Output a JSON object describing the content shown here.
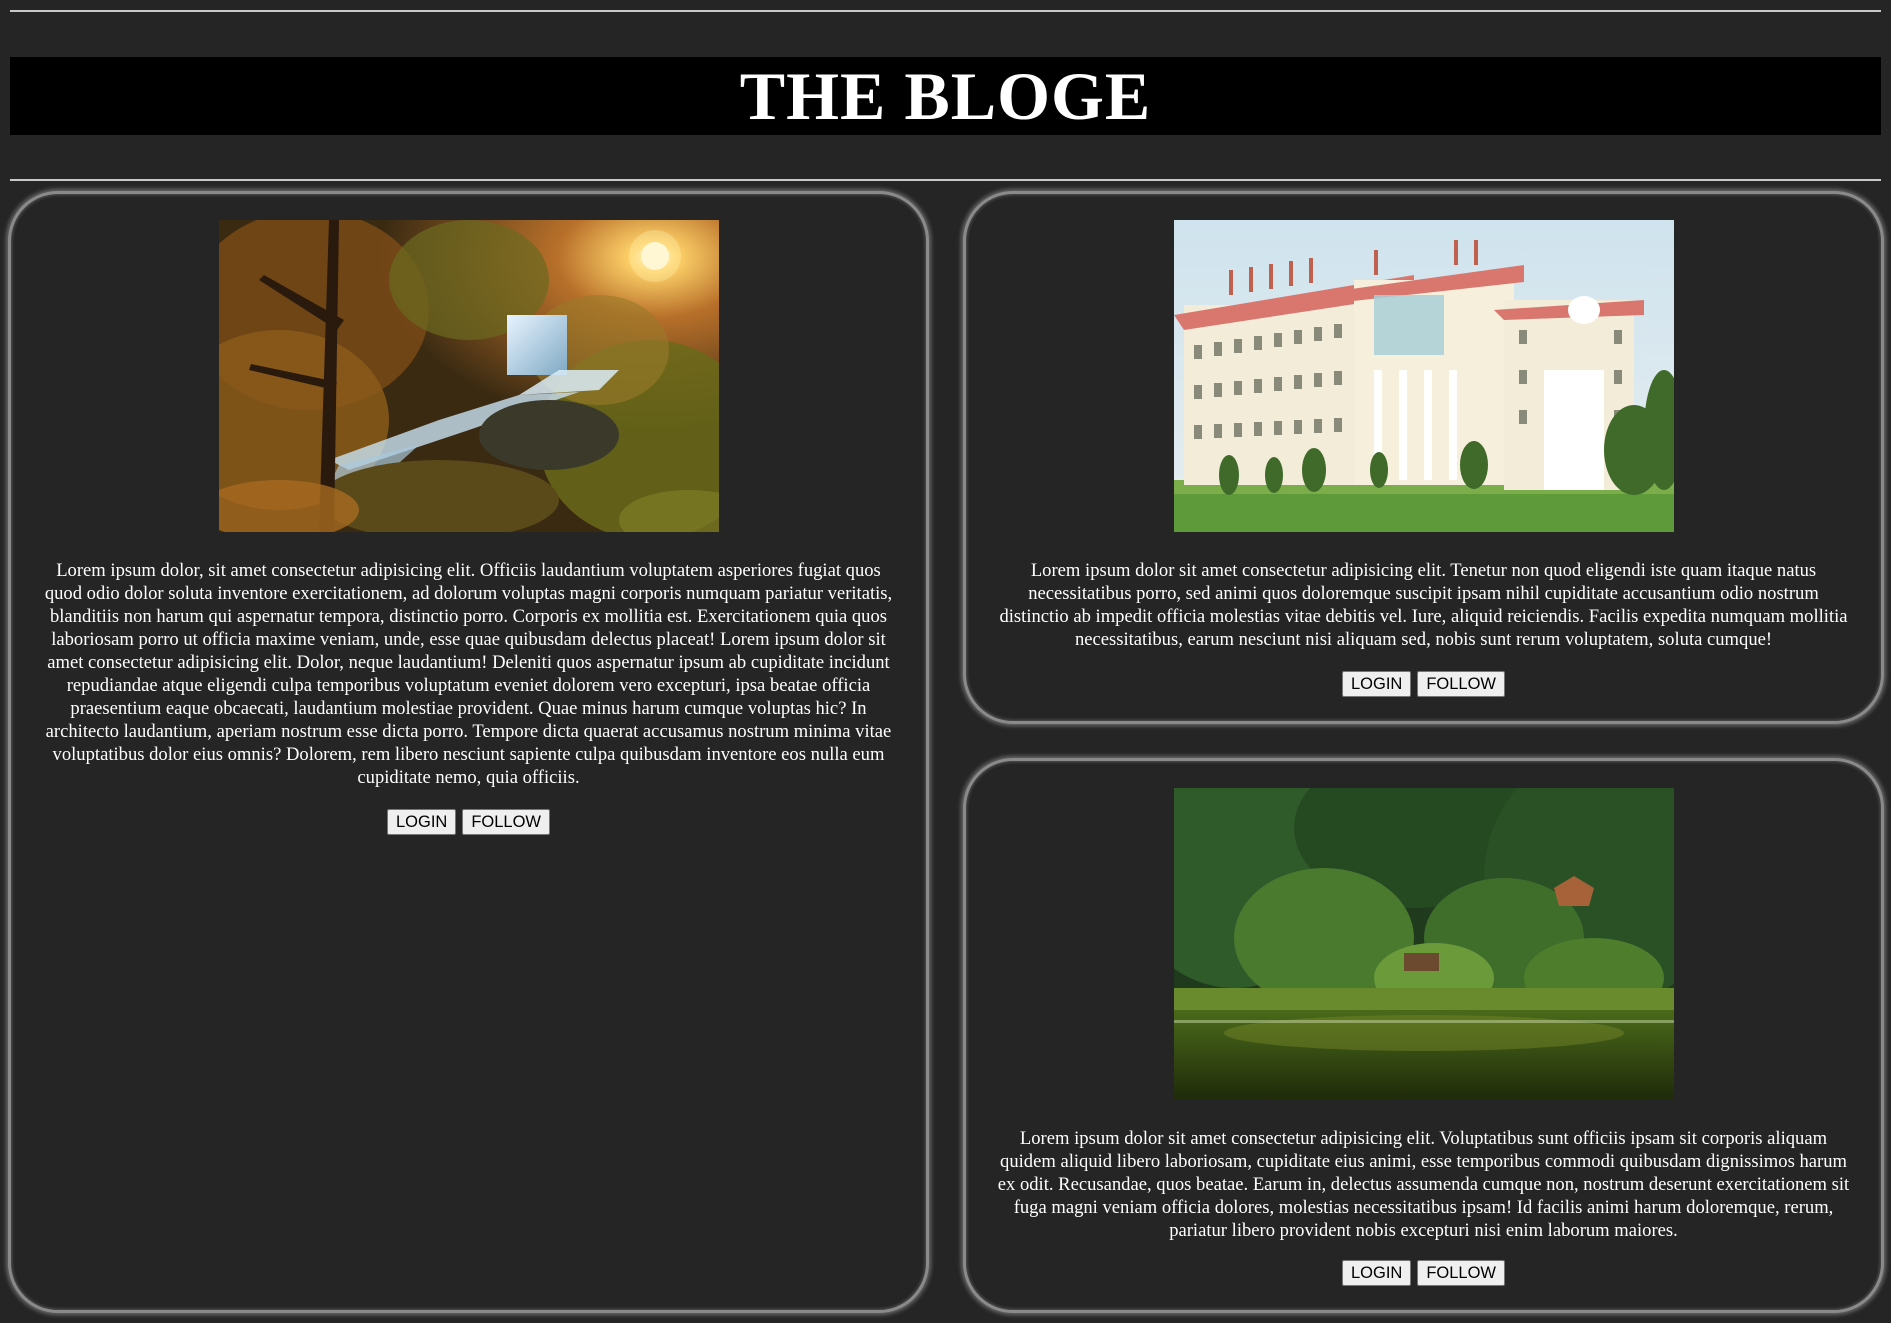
{
  "header": {
    "title": "THE BLOGE"
  },
  "posts": [
    {
      "image_desc": "autumn-forest-waterfall",
      "text": "Lorem ipsum dolor, sit amet consectetur adipisicing elit. Officiis laudantium voluptatem asperiores fugiat quos quod odio dolor soluta inventore exercitationem, ad dolorum voluptas magni corporis numquam pariatur veritatis, blanditiis non harum qui aspernatur tempora, distinctio porro. Corporis ex mollitia est. Exercitationem quia quos laboriosam porro ut officia maxime veniam, unde, esse quae quibusdam delectus placeat! Lorem ipsum dolor sit amet consectetur adipisicing elit. Dolor, neque laudantium! Deleniti quos aspernatur ipsum ab cupiditate incidunt repudiandae atque eligendi culpa temporibus voluptatum eveniet dolorem vero excepturi, ipsa beatae officia praesentium eaque obcaecati, laudantium molestiae provident. Quae minus harum cumque voluptas hic? In architecto laudantium, aperiam nostrum esse dicta porro. Tempore dicta quaerat accusamus nostrum minima vitae voluptatibus dolor eius omnis? Dolorem, rem libero nesciunt sapiente culpa quibusdam inventore eos nulla eum cupiditate nemo, quia officiis.",
      "login_label": "LOGIN",
      "follow_label": "FOLLOW"
    },
    {
      "image_desc": "white-building-red-roof",
      "text": "Lorem ipsum dolor sit amet consectetur adipisicing elit. Tenetur non quod eligendi iste quam itaque natus necessitatibus porro, sed animi quos doloremque suscipit ipsam nihil cupiditate accusantium odio nostrum distinctio ab impedit officia molestias vitae debitis vel. Iure, aliquid reiciendis. Facilis expedita numquam mollitia necessitatibus, earum nesciunt nisi aliquam sed, nobis sunt rerum voluptatem, soluta cumque!",
      "login_label": "LOGIN",
      "follow_label": "FOLLOW"
    },
    {
      "image_desc": "forest-lake-cabin",
      "text": "Lorem ipsum dolor sit amet consectetur adipisicing elit. Voluptatibus sunt officiis ipsam sit corporis aliquam quidem aliquid libero laboriosam, cupiditate eius animi, esse temporibus commodi quibusdam dignissimos harum ex odit. Recusandae, quos beatae. Earum in, delectus assumenda cumque non, nostrum deserunt exercitationem sit fuga magni veniam officia dolores, molestias necessitatibus ipsam! Id facilis animi harum doloremque, rerum, pariatur libero provident nobis excepturi nisi enim laborum maiores.",
      "login_label": "LOGIN",
      "follow_label": "FOLLOW"
    }
  ],
  "colors": {
    "page_background": "#252525",
    "title_background": "#000000",
    "title_text": "#ffffff",
    "card_border": "#8a8a8a",
    "button_background": "#efefef"
  }
}
